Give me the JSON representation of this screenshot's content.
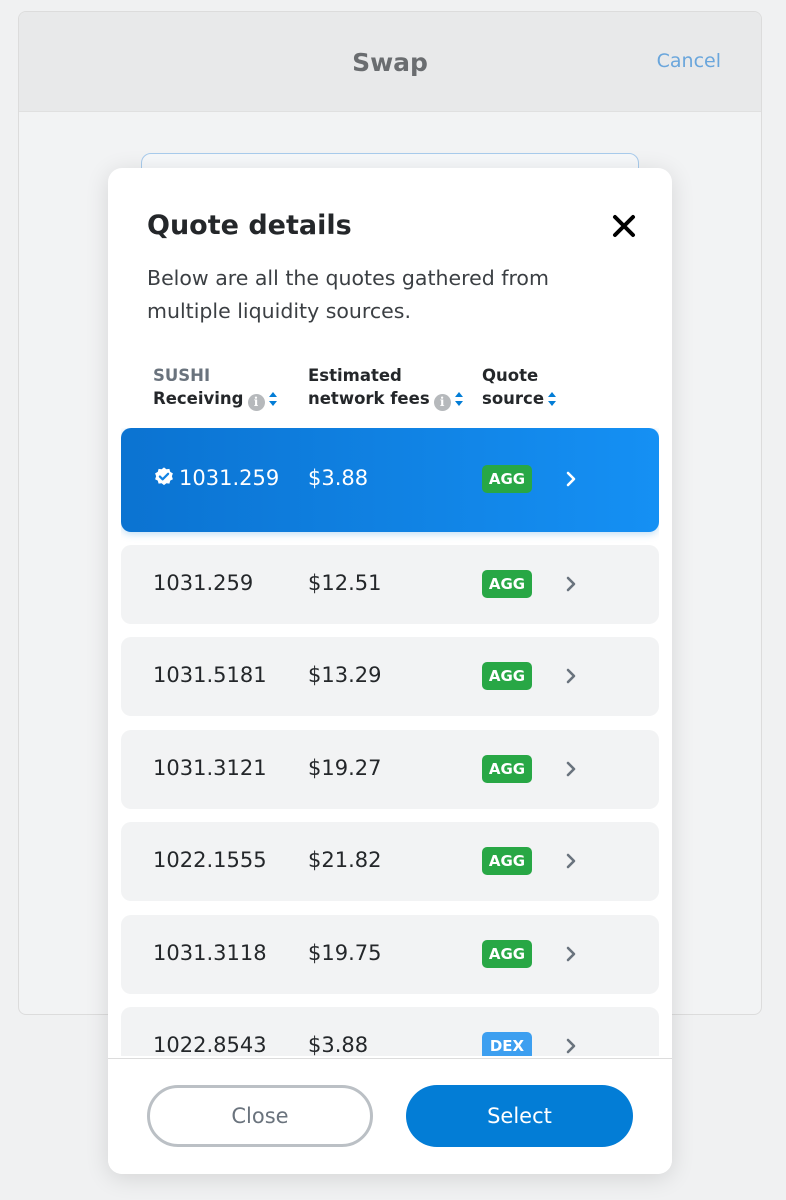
{
  "background": {
    "title": "Swap",
    "cancel_label": "Cancel"
  },
  "modal": {
    "title": "Quote details",
    "description": "Below are all the quotes gathered from multiple liquidity sources.",
    "columns": {
      "receiving_token": "SUSHI",
      "receiving_label": "Receiving",
      "fees_line1": "Estimated",
      "fees_line2": "network fees",
      "source_line1": "Quote",
      "source_line2": "source"
    },
    "rows": [
      {
        "receiving": "1031.259",
        "fee": "$3.88",
        "source": "AGG",
        "selected": true
      },
      {
        "receiving": "1031.259",
        "fee": "$12.51",
        "source": "AGG"
      },
      {
        "receiving": "1031.5181",
        "fee": "$13.29",
        "source": "AGG"
      },
      {
        "receiving": "1031.3121",
        "fee": "$19.27",
        "source": "AGG"
      },
      {
        "receiving": "1022.1555",
        "fee": "$21.82",
        "source": "AGG"
      },
      {
        "receiving": "1031.3118",
        "fee": "$19.75",
        "source": "AGG"
      },
      {
        "receiving": "1022.8543",
        "fee": "$3.88",
        "source": "DEX"
      }
    ],
    "close_label": "Close",
    "select_label": "Select"
  },
  "colors": {
    "primary": "#037dd6",
    "agg_badge": "#28a745",
    "dex_badge": "#3d9ff0"
  }
}
